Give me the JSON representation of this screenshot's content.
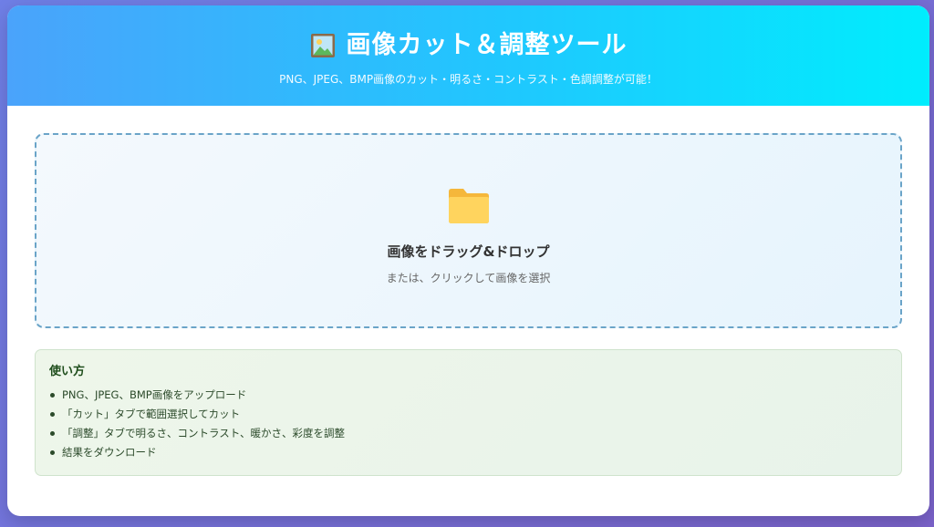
{
  "header": {
    "title": "画像カット＆調整ツール",
    "subtitle": "PNG、JPEG、BMP画像のカット・明るさ・コントラスト・色調調整が可能！",
    "icon": "framed-picture-icon"
  },
  "upload": {
    "icon": "folder-icon",
    "title": "画像をドラッグ&ドロップ",
    "subtitle": "または、クリックして画像を選択"
  },
  "howto": {
    "title": "使い方",
    "items": [
      "PNG、JPEG、BMP画像をアップロード",
      "「カット」タブで範囲選択してカット",
      "「調整」タブで明るさ、コントラスト、暖かさ、彩度を調整",
      "結果をダウンロード"
    ]
  },
  "colors": {
    "header_gradient_start": "#4aa3fb",
    "header_gradient_end": "#00edfd",
    "background_gradient_start": "#6f7fe6",
    "background_gradient_end": "#7a62c9",
    "dropzone_border": "#6aa4c8",
    "howto_text": "#1e4d1b"
  }
}
